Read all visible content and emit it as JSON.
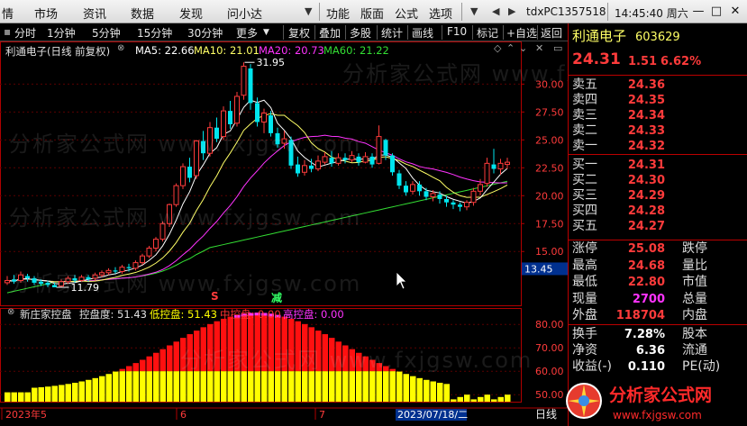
{
  "menubar": {
    "items": [
      "市场",
      "资讯",
      "数据",
      "发现",
      "问小达",
      "功能",
      "版面",
      "公式",
      "选项"
    ],
    "left_cut": "情",
    "account": "tdxPC1357518",
    "clock": "14:45:40 周六"
  },
  "toolbar": {
    "periods": [
      "分时",
      "1分钟",
      "5分钟",
      "15分钟",
      "30分钟",
      "更多"
    ],
    "actions": [
      "复权",
      "叠加",
      "多股",
      "统计",
      "画线",
      "F10",
      "标记",
      "+自选",
      "返回"
    ]
  },
  "main_legend": {
    "title": "利通电子(日线 前复权)",
    "ma5": "MA5: 22.66",
    "ma10": "MA10: 21.01",
    "ma20": "MA20: 20.73",
    "ma60": "MA60: 21.22"
  },
  "price_axis": {
    "ticks": [
      "30.00",
      "27.50",
      "25.00",
      "22.50",
      "20.00",
      "17.50",
      "15.00"
    ],
    "cursor_price": "13.45"
  },
  "annotations": {
    "high": "31.95",
    "low": "11.79",
    "buy": "S",
    "reduce": "减"
  },
  "sub_legend": {
    "title": "新庄家控盘",
    "control": "控盘度: 51.43",
    "low": "低控盘: 51.43",
    "mid": "中控盘: 0.00",
    "high": "高控盘: 0.00"
  },
  "sub_axis": {
    "ticks": [
      "80.00",
      "70.00",
      "60.00",
      "50.00"
    ]
  },
  "time_axis": {
    "labels": [
      "2023年5",
      "6",
      "7"
    ],
    "cursor_date": "2023/07/18/二",
    "period": "日线"
  },
  "quote": {
    "name": "利通电子",
    "code": "603629",
    "price": "24.31",
    "change": "1.51",
    "change_pct": "6.62%",
    "asks": [
      {
        "label": "卖五",
        "price": "24.36"
      },
      {
        "label": "卖四",
        "price": "24.35"
      },
      {
        "label": "卖三",
        "price": "24.34"
      },
      {
        "label": "卖二",
        "price": "24.33"
      },
      {
        "label": "卖一",
        "price": "24.32"
      }
    ],
    "bids": [
      {
        "label": "买一",
        "price": "24.31"
      },
      {
        "label": "买二",
        "price": "24.30"
      },
      {
        "label": "买三",
        "price": "24.29"
      },
      {
        "label": "买四",
        "price": "24.28"
      },
      {
        "label": "买五",
        "price": "24.27"
      }
    ],
    "stats": [
      {
        "label": "涨停",
        "value": "25.08",
        "label2": "跌停"
      },
      {
        "label": "最高",
        "value": "24.68",
        "label2": "量比"
      },
      {
        "label": "最低",
        "value": "22.80",
        "label2": "市值"
      },
      {
        "label": "现量",
        "value": "2700",
        "label2": "总量"
      },
      {
        "label": "外盘",
        "value": "118704",
        "label2": "内盘"
      }
    ],
    "stats2": [
      {
        "label": "换手",
        "value": "7.28%",
        "label2": "股本"
      },
      {
        "label": "净资",
        "value": "6.36",
        "label2": "流通"
      },
      {
        "label": "收益(-)",
        "value": "0.110",
        "label2": "PE(动)"
      }
    ]
  },
  "watermark": "分析家公式网 www.fxjgsw.com",
  "logo": {
    "title": "分析家公式网",
    "url": "www.fxjgsw.com"
  },
  "colors": {
    "up": "#ff3b3b",
    "down": "#00e5ee",
    "ma5": "#ffffff",
    "ma10": "#ffff66",
    "ma20": "#ff33ff",
    "ma60": "#33dd33",
    "grid": "#b00000",
    "ctrl_red": "#ff1010",
    "ctrl_yellow": "#ffff00"
  }
}
